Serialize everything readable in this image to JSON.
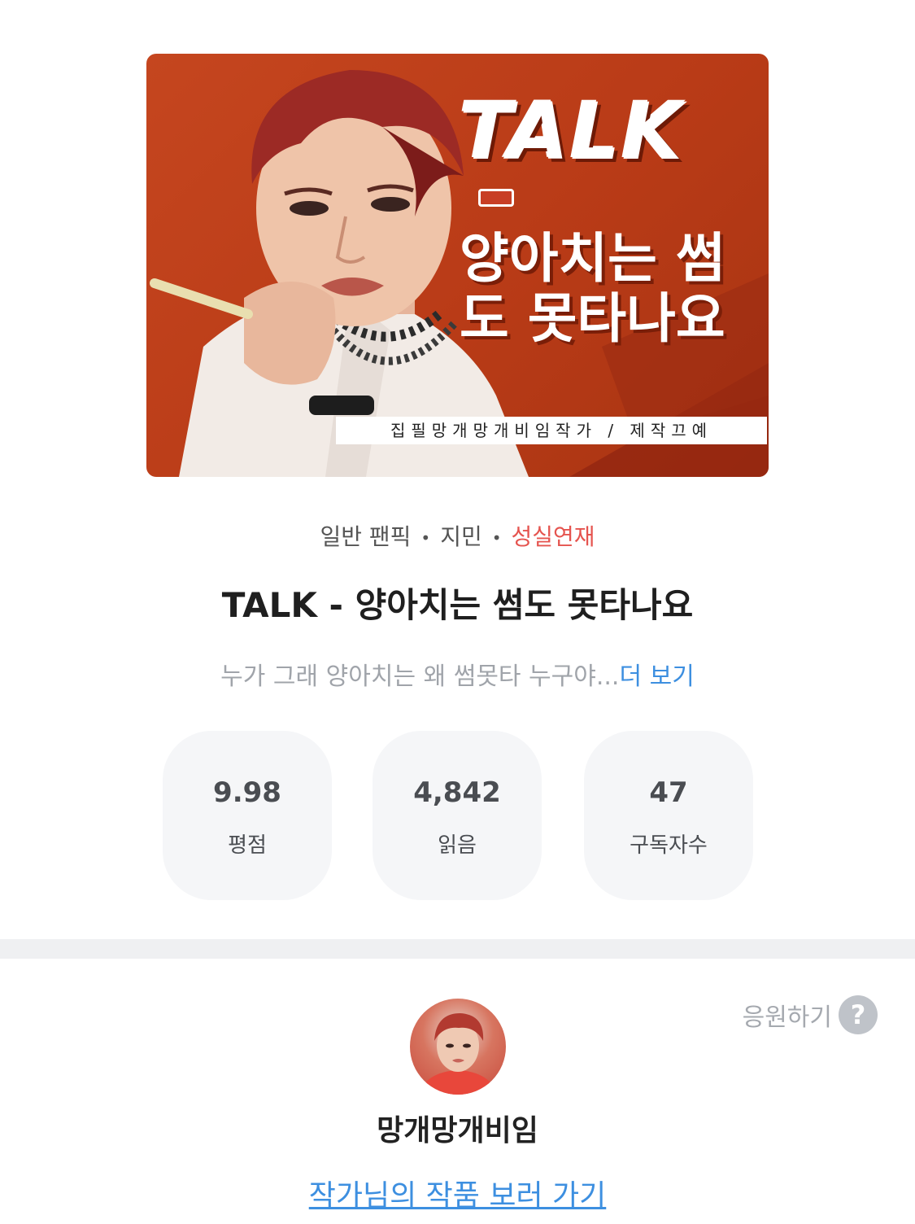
{
  "cover": {
    "title_line1": "TALK",
    "title_line2": "양아치는 썸도 못타나요",
    "credit": "집필망개망개비임작가 / 제작끄예"
  },
  "meta": {
    "category": "일반 팬픽",
    "character": "지민",
    "status": "성실연재",
    "separator": "•",
    "status_color": "#e5544f"
  },
  "title": "TALK - 양아치는 썸도 못타나요",
  "description": {
    "text": "누가 그래 양아치는 왜 썸못타 누구야...",
    "more_label": "더 보기"
  },
  "stats": [
    {
      "value": "9.98",
      "label": "평점"
    },
    {
      "value": "4,842",
      "label": "읽음"
    },
    {
      "value": "47",
      "label": "구독자수"
    }
  ],
  "support": {
    "label": "응원하기",
    "icon": "question-icon"
  },
  "author": {
    "name": "망개망개비임",
    "link_label": "작가님의 작품 보러 가기"
  },
  "colors": {
    "accent": "#3d8fe0",
    "status": "#e5544f"
  }
}
